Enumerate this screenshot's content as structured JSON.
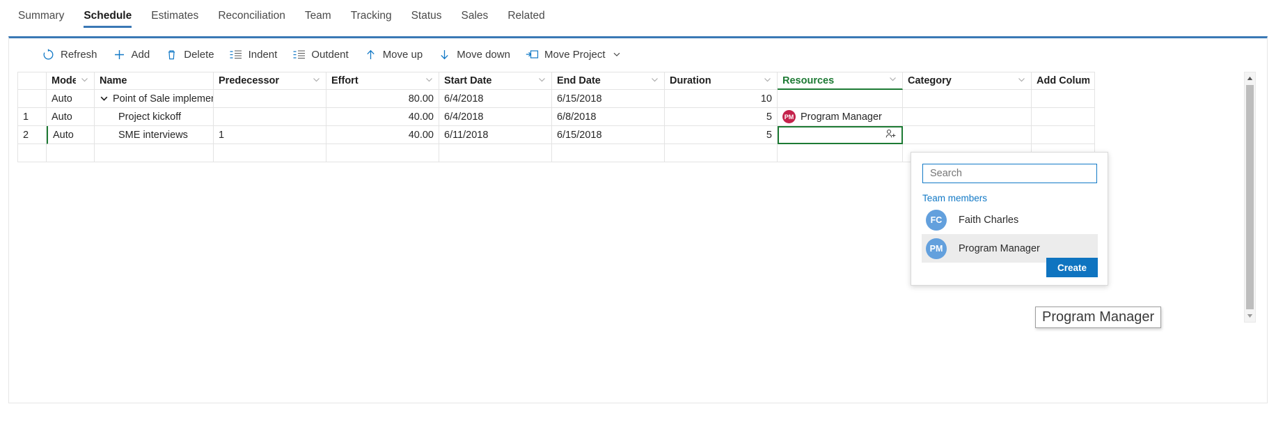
{
  "tabs": [
    {
      "label": "Summary",
      "active": false
    },
    {
      "label": "Schedule",
      "active": true
    },
    {
      "label": "Estimates",
      "active": false
    },
    {
      "label": "Reconciliation",
      "active": false
    },
    {
      "label": "Team",
      "active": false
    },
    {
      "label": "Tracking",
      "active": false
    },
    {
      "label": "Status",
      "active": false
    },
    {
      "label": "Sales",
      "active": false
    },
    {
      "label": "Related",
      "active": false
    }
  ],
  "toolbar": {
    "refresh_label": "Refresh",
    "add_label": "Add",
    "delete_label": "Delete",
    "indent_label": "Indent",
    "outdent_label": "Outdent",
    "move_up_label": "Move up",
    "move_down_label": "Move down",
    "move_project_label": "Move Project"
  },
  "grid": {
    "headers": {
      "index": "",
      "mode": "Mode",
      "name": "Name",
      "predecessor": "Predecessor",
      "effort": "Effort",
      "start_date": "Start Date",
      "end_date": "End Date",
      "duration": "Duration",
      "resources": "Resources",
      "category": "Category",
      "add_column": "Add Column"
    },
    "rows": [
      {
        "index": "",
        "mode": "Auto",
        "name": "Point of Sale implementati",
        "predecessor": "",
        "effort": "80.00",
        "start_date": "6/4/2018",
        "end_date": "6/15/2018",
        "duration": "10",
        "resource_name": "",
        "resource_initials": "",
        "category": ""
      },
      {
        "index": "1",
        "mode": "Auto",
        "name": "Project kickoff",
        "predecessor": "",
        "effort": "40.00",
        "start_date": "6/4/2018",
        "end_date": "6/8/2018",
        "duration": "5",
        "resource_name": "Program Manager",
        "resource_initials": "PM",
        "category": ""
      },
      {
        "index": "2",
        "mode": "Auto",
        "name": "SME interviews",
        "predecessor": "1",
        "effort": "40.00",
        "start_date": "6/11/2018",
        "end_date": "6/15/2018",
        "duration": "5",
        "resource_name": "",
        "resource_initials": "",
        "category": ""
      }
    ]
  },
  "resource_dropdown": {
    "search_placeholder": "Search",
    "search_value": "",
    "section_label": "Team members",
    "members": [
      {
        "initials": "FC",
        "name": "Faith Charles",
        "selected": false
      },
      {
        "initials": "PM",
        "name": "Program Manager",
        "selected": true
      }
    ],
    "create_label": "Create"
  },
  "tooltip": {
    "text": "Program Manager"
  },
  "colors": {
    "accent_blue": "#3a78b5",
    "link_blue": "#1279c6",
    "button_blue": "#0f74c0",
    "focus_green": "#1d7a34",
    "avatar_crimson": "#c4224b",
    "avatar_blue": "#63a0dd"
  }
}
